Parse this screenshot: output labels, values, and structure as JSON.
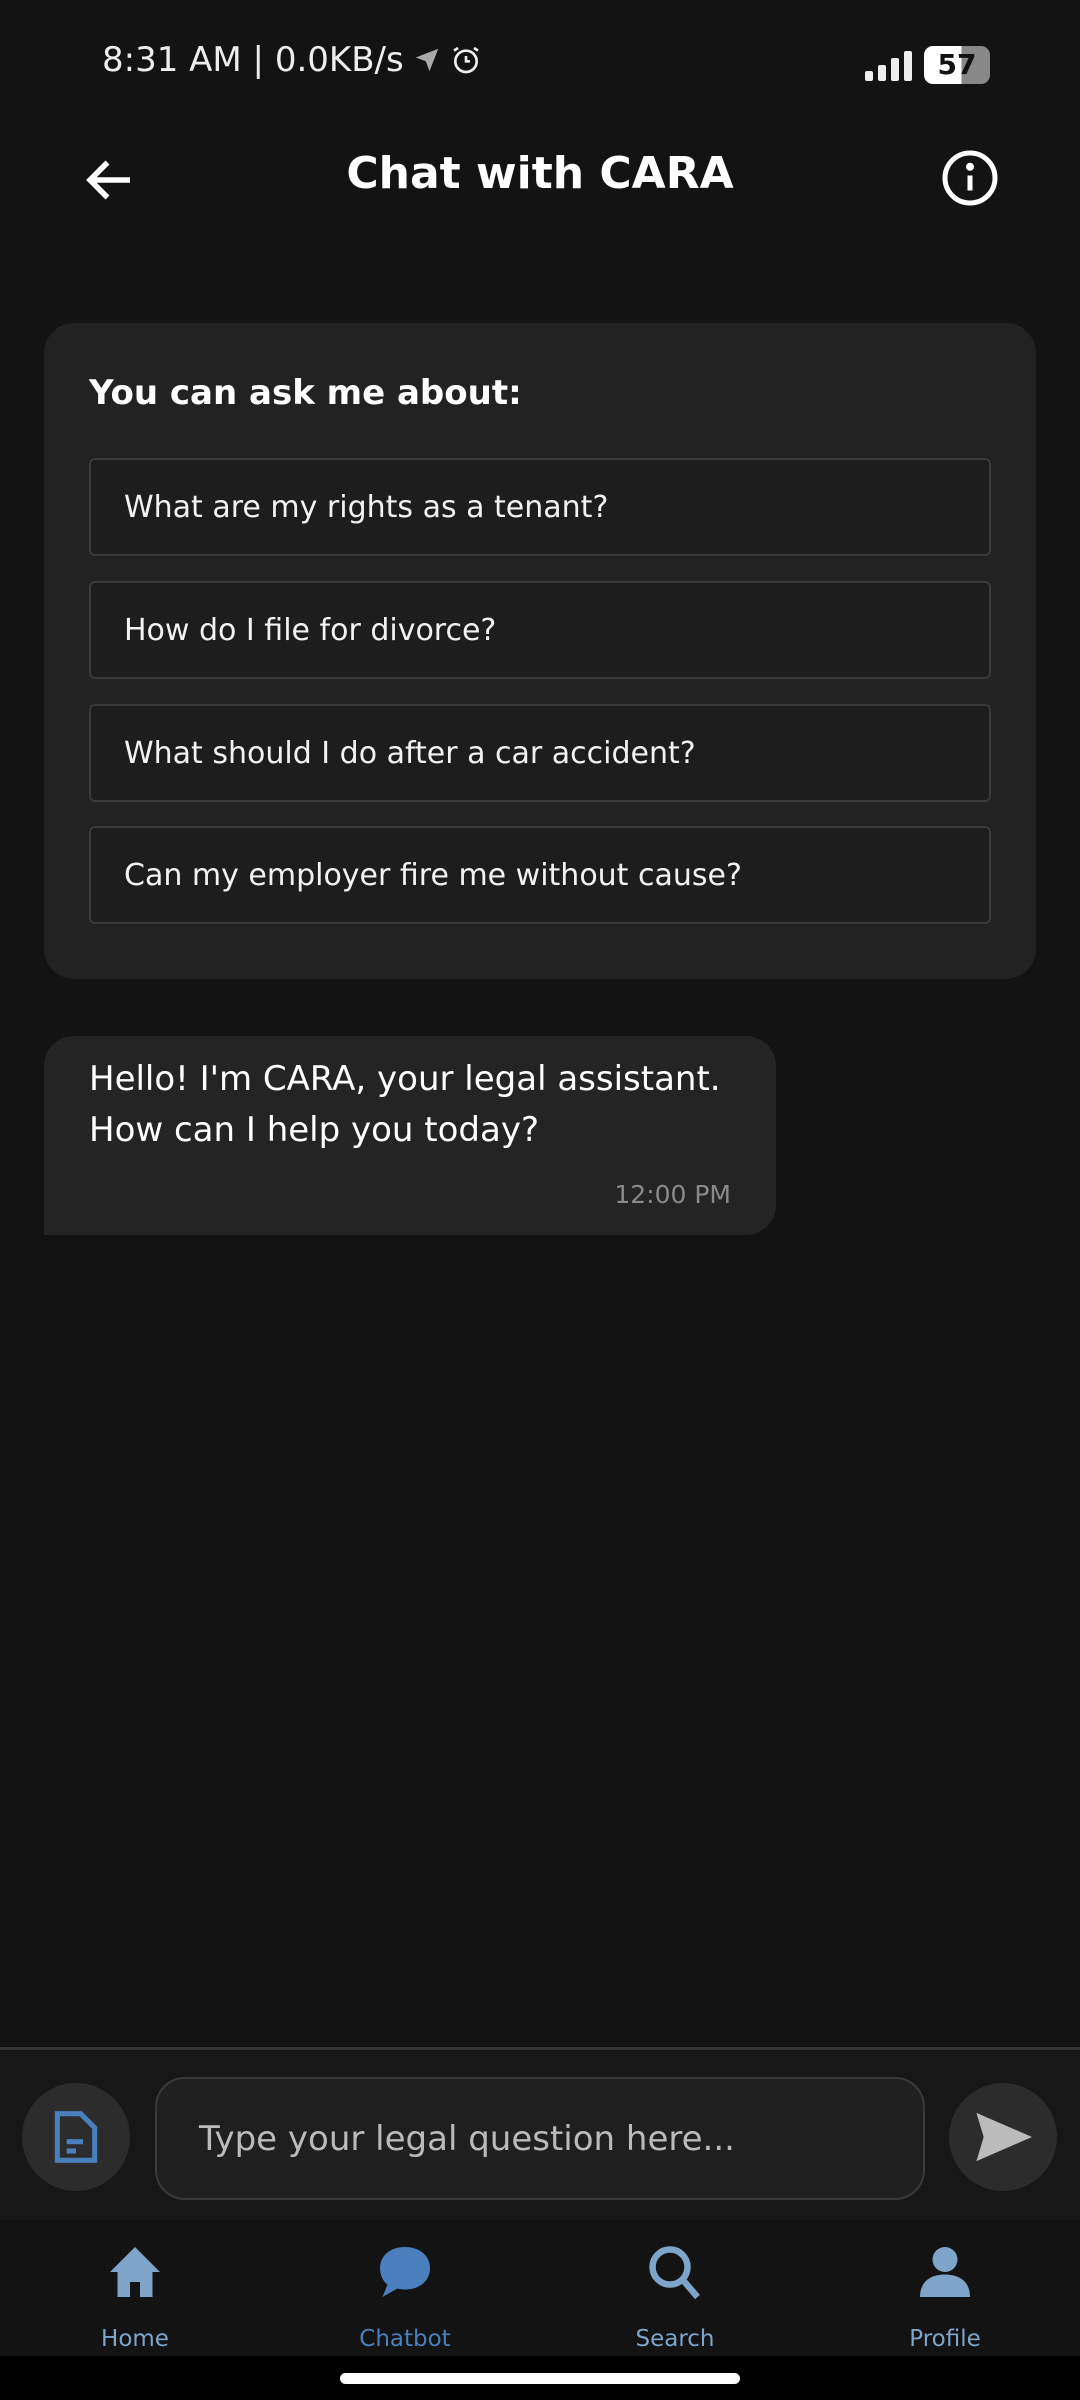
{
  "status_bar": {
    "left_text": "8:31 AM | 0.0KB/s",
    "battery": "57"
  },
  "header": {
    "title": "Chat with CARA"
  },
  "suggestions": {
    "title": "You can ask me about:",
    "items": [
      "What are my rights as a tenant?",
      "How do I file for divorce?",
      "What should I do after a car accident?",
      "Can my employer fire me without cause?"
    ]
  },
  "messages": [
    {
      "text": "Hello! I'm CARA, your legal assistant. How can I help you today?",
      "time": "12:00 PM"
    }
  ],
  "composer": {
    "placeholder": "Type your legal question here..."
  },
  "nav": {
    "items": [
      {
        "label": "Home"
      },
      {
        "label": "Chatbot"
      },
      {
        "label": "Search"
      },
      {
        "label": "Profile"
      }
    ],
    "active": "Chatbot"
  },
  "colors": {
    "accent": "#4a7fbd",
    "nav_icon": "#7ea4c9"
  }
}
